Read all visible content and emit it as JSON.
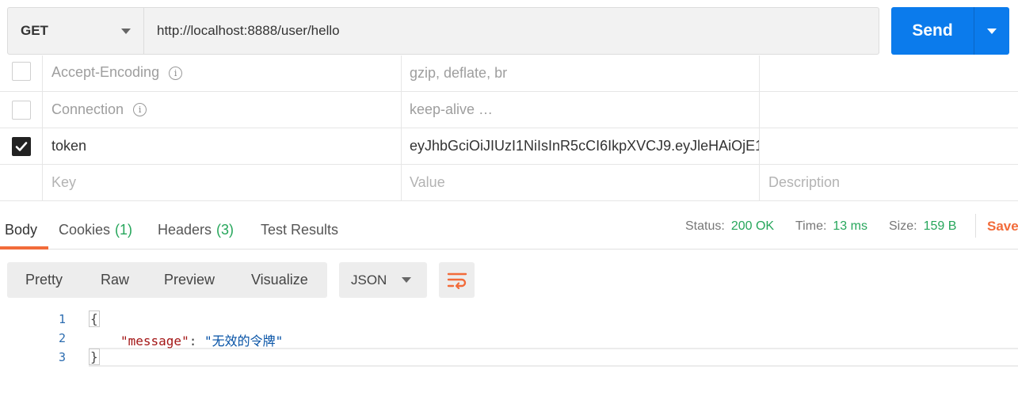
{
  "request": {
    "method": "GET",
    "url": "http://localhost:8888/user/hello",
    "send_label": "Send"
  },
  "headers_table": {
    "rows": [
      {
        "key": "Accept-Encoding",
        "value": "gzip, deflate, br",
        "description": "",
        "checked": false,
        "has_info": true
      },
      {
        "key": "Connection",
        "value": "keep-alive …",
        "description": "",
        "checked": false,
        "has_info": true
      },
      {
        "key": "token",
        "value": "eyJhbGciOiJIUzI1NiIsInR5cCI6IkpXVCJ9.eyJleHAiOjE1(",
        "description": "",
        "checked": true,
        "has_info": false
      }
    ],
    "placeholder": {
      "key": "Key",
      "value": "Value",
      "description": "Description"
    }
  },
  "response_tabs": {
    "body": "Body",
    "cookies": "Cookies",
    "cookies_count": "(1)",
    "headers": "Headers",
    "headers_count": "(3)",
    "test_results": "Test Results"
  },
  "response_status": {
    "status_label": "Status:",
    "status_value": "200 OK",
    "time_label": "Time:",
    "time_value": "13 ms",
    "size_label": "Size:",
    "size_value": "159 B",
    "save_label": "Save"
  },
  "format_bar": {
    "pretty": "Pretty",
    "raw": "Raw",
    "preview": "Preview",
    "visualize": "Visualize",
    "language": "JSON"
  },
  "response_body": {
    "lines": [
      {
        "num": "1",
        "open": "{"
      },
      {
        "num": "2",
        "key": "\"message\"",
        "sep": ": ",
        "value": "\"无效的令牌\""
      },
      {
        "num": "3",
        "close": "}"
      }
    ]
  },
  "colors": {
    "accent_send": "#0b7bec",
    "tab_active": "#f26b3a",
    "success": "#26a65b"
  }
}
